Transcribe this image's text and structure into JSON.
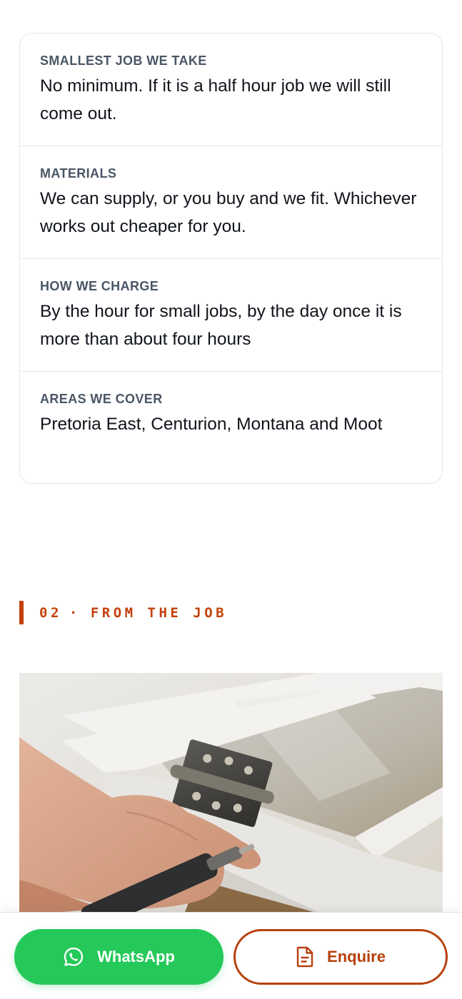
{
  "info": {
    "items": [
      {
        "label": "SMALLEST JOB WE TAKE",
        "value": "No minimum. If it is a half hour job we will still come out."
      },
      {
        "label": "MATERIALS",
        "value": "We can supply, or you buy and we fit. Whichever works out cheaper for you."
      },
      {
        "label": "HOW WE CHARGE",
        "value": "By the hour for small jobs, by the day once it is more than about four hours"
      },
      {
        "label": "AREAS WE COVER",
        "value": "Pretoria East, Centurion, Montana and Moot"
      }
    ]
  },
  "section": {
    "number": "02",
    "separator": "·",
    "title": "FROM THE JOB"
  },
  "photo": {
    "subject": "hand fitting a metal hinge to a white window frame with a power drill"
  },
  "actions": {
    "whatsapp_label": "WhatsApp",
    "whatsapp_icon": "whatsapp-icon",
    "enquire_label": "Enquire",
    "enquire_icon": "document-icon"
  },
  "colors": {
    "accent": "#c2410c",
    "whatsapp": "#25c95a",
    "label_text": "#4a5666"
  }
}
